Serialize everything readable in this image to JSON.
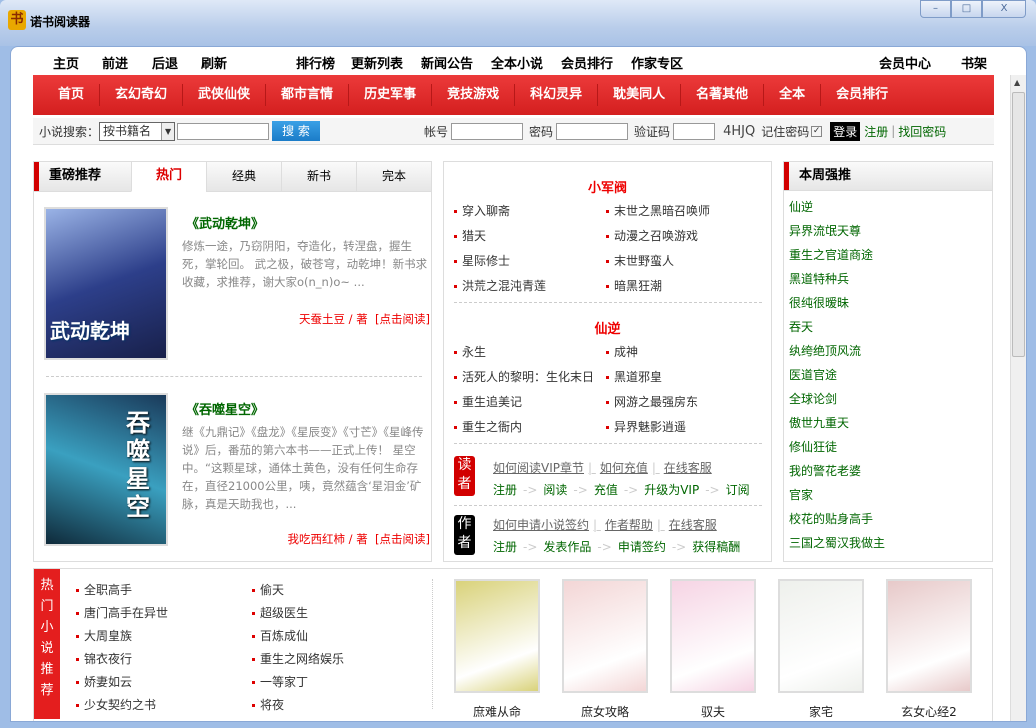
{
  "window": {
    "title": "诺书阅读器",
    "icon": "book-app-icon",
    "min": "–",
    "max": "□",
    "close": "X"
  },
  "topnav": {
    "left": [
      "主页",
      "前进",
      "后退",
      "刷新"
    ],
    "center": [
      "排行榜",
      "更新列表",
      "新闻公告",
      "全本小说",
      "会员排行",
      "作家专区"
    ],
    "right": [
      "会员中心",
      "书架"
    ]
  },
  "categories": [
    "首页",
    "玄幻奇幻",
    "武侠仙侠",
    "都市言情",
    "历史军事",
    "竞技游戏",
    "科幻灵异",
    "耽美同人",
    "名著其他",
    "全本",
    "会员排行"
  ],
  "search": {
    "label": "小说搜索：",
    "select": "按书籍名",
    "button": "搜 索",
    "account": "帐号",
    "password": "密码",
    "captcha": "验证码",
    "captcha_code": "4HJQ",
    "remember": "记住密码",
    "login": "登录",
    "register": "注册",
    "forgot": "找回密码"
  },
  "featured": {
    "header": "重磅推荐",
    "tabs": [
      "热门",
      "经典",
      "新书",
      "完本"
    ],
    "books": [
      {
        "title": "《武动乾坤》",
        "desc": "修炼一途，乃窃阴阳，夺造化，转涅盘，握生死，掌轮回。 武之极，破苍穹，动乾坤！新书求收藏，求推荐，谢大家o(n_n)o~ ...",
        "author": "天蚕土豆 / 著",
        "read": "[点击阅读]",
        "cover_text": "武动乾坤"
      },
      {
        "title": "《吞噬星空》",
        "desc": "继《九鼎记》《盘龙》《星辰变》《寸芒》《星峰传说》后，番茄的第六本书——正式上传！ 星空中。“这颗星球，通体土黄色，没有任何生命存在，直径21000公里，咦，竟然蕴含‘星泪金’矿脉，真是天助我也，...",
        "author": "我吃西红柿 / 著",
        "read": "[点击阅读]",
        "cover_text": "吞噬星空"
      }
    ]
  },
  "middle": {
    "section1": {
      "title": "小军阀",
      "items": [
        "穿入聊斋",
        "末世之黑暗召唤师",
        "猎天",
        "动漫之召唤游戏",
        "星际修士",
        "末世野蛮人",
        "洪荒之混沌青莲",
        "暗黑狂潮"
      ]
    },
    "section2": {
      "title": "仙逆",
      "items": [
        "永生",
        "成神",
        "活死人的黎明：生化末日",
        "黑道邪皇",
        "重生追美记",
        "网游之最强房东",
        "重生之衙内",
        "异界魅影逍遥"
      ]
    },
    "reader": {
      "badge": "读者",
      "links": [
        "如何阅读VIP章节",
        "如何充值",
        "在线客服"
      ],
      "steps": [
        "注册",
        "阅读",
        "充值",
        "升级为VIP",
        "订阅"
      ]
    },
    "author": {
      "badge": "作者",
      "links": [
        "如何申请小说签约",
        "作者帮助",
        "在线客服"
      ],
      "steps": [
        "注册",
        "发表作品",
        "申请签约",
        "获得稿酬"
      ]
    },
    "arrow": "->"
  },
  "weekly": {
    "header": "本周强推",
    "items": [
      "仙逆",
      "异界流氓天尊",
      "重生之官道商途",
      "黑道特种兵",
      "很纯很暧昧",
      "吞天",
      "纨绔绝顶风流",
      "医道官途",
      "全球论剑",
      "傲世九重天",
      "修仙狂徒",
      "我的警花老婆",
      "官家",
      "校花的贴身高手",
      "三国之蜀汉我做主"
    ]
  },
  "hot": {
    "label": "热门小说推荐",
    "items": [
      "全职高手",
      "偷天",
      "唐门高手在异世",
      "超级医生",
      "大周皇族",
      "百炼成仙",
      "锦衣夜行",
      "重生之网络娱乐",
      "娇妻如云",
      "一等家丁",
      "少女契约之书",
      "将夜"
    ],
    "covers": [
      {
        "name": "庶难从命",
        "bg": "#d9d27a"
      },
      {
        "name": "庶女攻略",
        "bg": "#f3d6d6"
      },
      {
        "name": "驭夫",
        "bg": "#f6d4e4"
      },
      {
        "name": "家宅",
        "bg": "#eef0ec"
      },
      {
        "name": "玄女心经2",
        "bg": "#e7c9c9"
      }
    ]
  },
  "colors": {
    "accent": "#d20000",
    "link_green": "#006600",
    "titlebar": "#b9cdea"
  }
}
